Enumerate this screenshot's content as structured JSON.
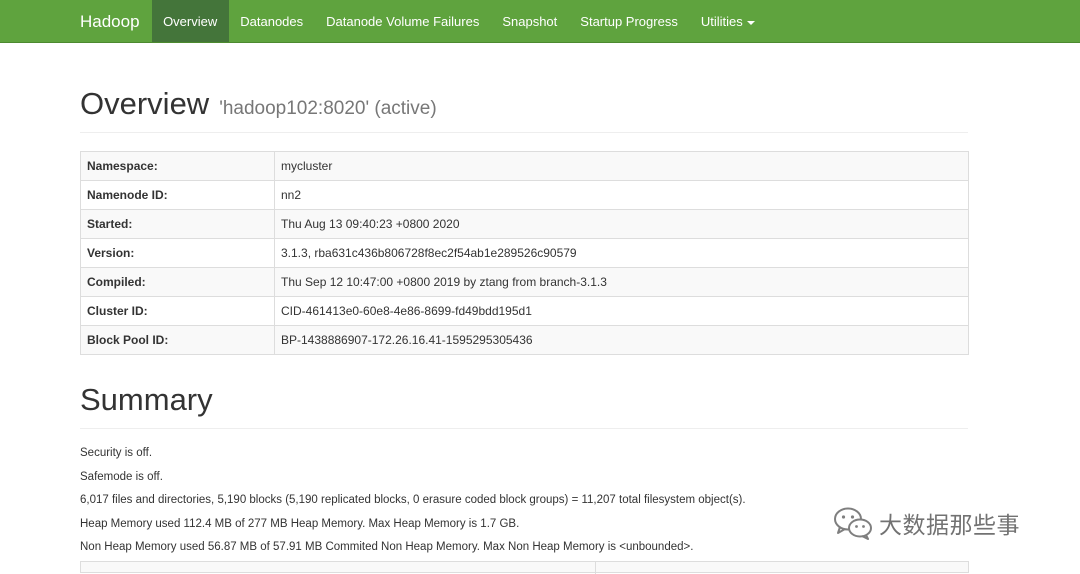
{
  "navbar": {
    "brand": "Hadoop",
    "items": [
      {
        "label": "Overview",
        "active": true
      },
      {
        "label": "Datanodes",
        "active": false
      },
      {
        "label": "Datanode Volume Failures",
        "active": false
      },
      {
        "label": "Snapshot",
        "active": false
      },
      {
        "label": "Startup Progress",
        "active": false
      },
      {
        "label": "Utilities",
        "active": false
      }
    ],
    "colors": {
      "background": "#5fa33e",
      "active": "#44753a"
    }
  },
  "header": {
    "title": "Overview",
    "subtitle": "'hadoop102:8020' (active)"
  },
  "info": {
    "rows": [
      {
        "key": "Namespace:",
        "value": "mycluster"
      },
      {
        "key": "Namenode ID:",
        "value": "nn2"
      },
      {
        "key": "Started:",
        "value": "Thu Aug 13 09:40:23 +0800 2020"
      },
      {
        "key": "Version:",
        "value": "3.1.3, rba631c436b806728f8ec2f54ab1e289526c90579"
      },
      {
        "key": "Compiled:",
        "value": "Thu Sep 12 10:47:00 +0800 2019 by ztang from branch-3.1.3"
      },
      {
        "key": "Cluster ID:",
        "value": "CID-461413e0-60e8-4e86-8699-fd49bdd195d1"
      },
      {
        "key": "Block Pool ID:",
        "value": "BP-1438886907-172.26.16.41-1595295305436"
      }
    ]
  },
  "summary": {
    "title": "Summary",
    "lines": [
      "Security is off.",
      "Safemode is off.",
      "6,017 files and directories, 5,190 blocks (5,190 replicated blocks, 0 erasure coded block groups) = 11,207 total filesystem object(s).",
      "Heap Memory used 112.4 MB of 277 MB Heap Memory. Max Heap Memory is 1.7 GB.",
      "Non Heap Memory used 56.87 MB of 57.91 MB Commited Non Heap Memory. Max Non Heap Memory is <unbounded>."
    ]
  },
  "watermark": {
    "icon": "wechat-icon",
    "text": "大数据那些事"
  }
}
